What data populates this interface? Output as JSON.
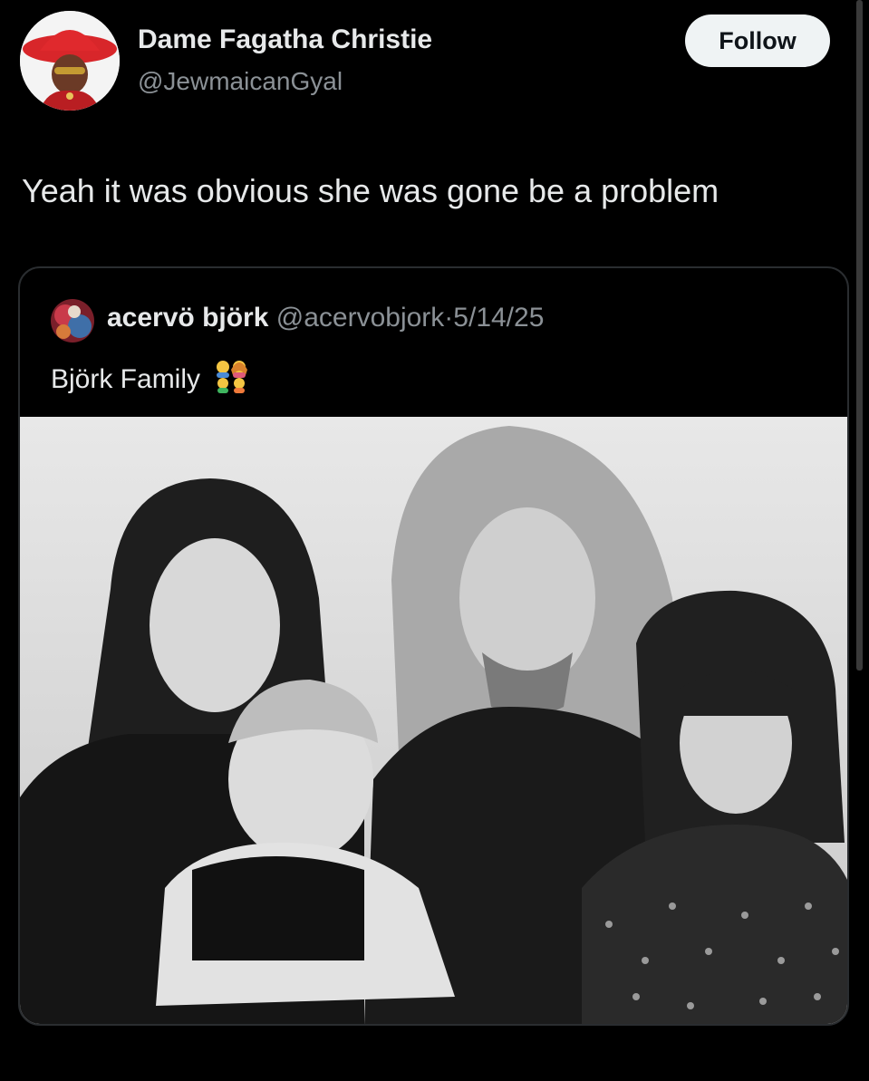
{
  "tweet": {
    "author": {
      "display_name": "Dame Fagatha Christie",
      "handle": "@JewmaicanGyal",
      "avatar_icon": "profile-photo-red-hat"
    },
    "follow_label": "Follow",
    "text": "Yeah it was obvious she was gone be a problem"
  },
  "quoted_tweet": {
    "author": {
      "display_name": "acervö björk",
      "handle": "@acervobjork",
      "avatar_icon": "profile-photo-colorful"
    },
    "separator": "·",
    "date": "5/14/25",
    "text": "Björk Family",
    "emoji_icon": "family-emoji",
    "image_icon": "black-and-white-family-photo"
  },
  "colors": {
    "background": "#000000",
    "primary_text": "#e7e9ea",
    "secondary_text": "#8b9196",
    "follow_button_bg": "#eff3f4",
    "card_border": "#2a2d30"
  }
}
